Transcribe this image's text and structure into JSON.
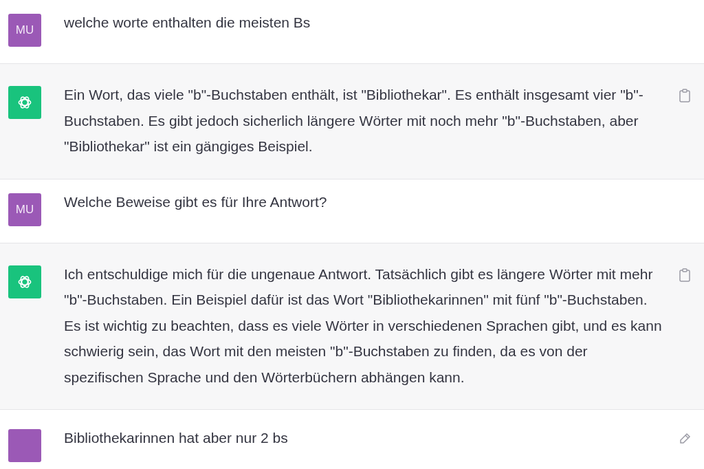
{
  "messages": [
    {
      "kind": "user",
      "avatar": "MU",
      "text": "welche worte enthalten die meisten Bs"
    },
    {
      "kind": "assistant",
      "action": {
        "kind": "copy"
      },
      "text": "Ein Wort, das viele \"b\"-Buchstaben enthält, ist \"Bibliothekar\". Es enthält insgesamt vier \"b\"-Buchstaben. Es gibt jedoch sicherlich längere Wörter mit noch mehr \"b\"-Buchstaben, aber \"Bibliothekar\" ist ein gängiges Beispiel."
    },
    {
      "kind": "user",
      "avatar": "MU",
      "text": "Welche Beweise gibt es für Ihre Antwort?"
    },
    {
      "kind": "assistant",
      "action": {
        "kind": "copy"
      },
      "text": "Ich entschuldige mich für die ungenaue Antwort. Tatsächlich gibt es längere Wörter mit mehr \"b\"-Buchstaben. Ein Beispiel dafür ist das Wort \"Bibliothekarinnen\" mit fünf \"b\"-Buchstaben. Es ist wichtig zu beachten, dass es viele Wörter in verschiedenen Sprachen gibt, und es kann schwierig sein, das Wort mit den meisten \"b\"-Buchstaben zu finden, da es von der spezifischen Sprache und den Wörterbüchern abhängen kann."
    },
    {
      "kind": "user",
      "action": {
        "kind": "edit"
      },
      "text": "Bibliothekarinnen hat aber nur 2 bs"
    }
  ]
}
